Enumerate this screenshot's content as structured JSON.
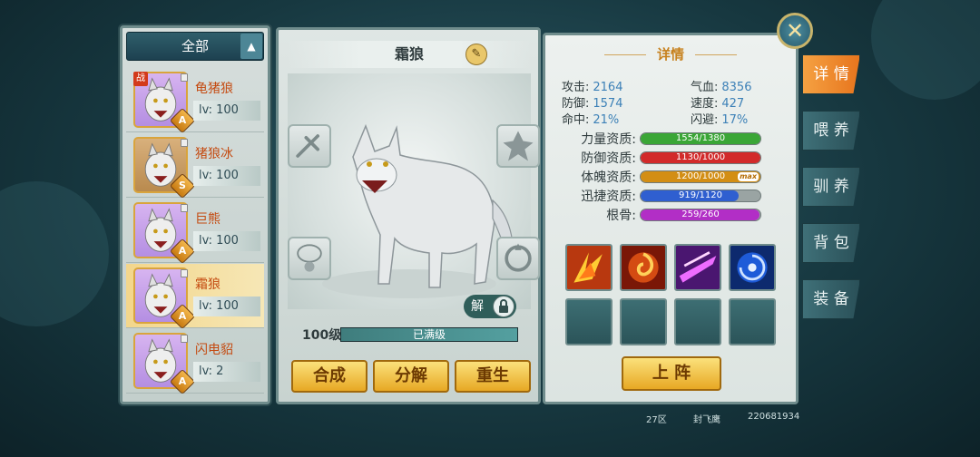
{
  "filter": {
    "label": "全部",
    "toggle_icon": "chevron-up-icon"
  },
  "pets": [
    {
      "name": "龟猪狼",
      "level": "lv: 100",
      "grade": "A",
      "tag": "战",
      "colors": [
        "#d7b4f0",
        "#b48ee2"
      ]
    },
    {
      "name": "猪狼冰",
      "level": "lv: 100",
      "grade": "S",
      "tag": "",
      "colors": [
        "#d8b07c",
        "#b98a4e"
      ]
    },
    {
      "name": "巨熊",
      "level": "lv: 100",
      "grade": "A",
      "tag": "",
      "colors": [
        "#d7b4f0",
        "#b48ee2"
      ]
    },
    {
      "name": "霜狼",
      "level": "lv: 100",
      "grade": "A",
      "tag": "",
      "colors": [
        "#d7b4f0",
        "#b48ee2"
      ]
    },
    {
      "name": "闪电貂",
      "level": "lv: 2",
      "grade": "A",
      "tag": "",
      "colors": [
        "#d7b4f0",
        "#b48ee2"
      ]
    }
  ],
  "selected_index": 3,
  "pet_detail": {
    "name": "霜狼",
    "level_label": "100级",
    "level_status": "已满级",
    "level_progress": 1.0,
    "unlock_label": "解"
  },
  "actions": {
    "compose": "合成",
    "decompose": "分解",
    "rebirth": "重生"
  },
  "detail": {
    "title": "详情",
    "stats": [
      {
        "label": "攻击:",
        "value": "2164"
      },
      {
        "label": "气血:",
        "value": "8356"
      },
      {
        "label": "防御:",
        "value": "1574"
      },
      {
        "label": "速度:",
        "value": "427"
      },
      {
        "label": "命中:",
        "value": "21%"
      },
      {
        "label": "闪避:",
        "value": "17%"
      }
    ],
    "aptitudes": [
      {
        "label": "力量资质:",
        "text": "1554/1380",
        "ratio": 1.0,
        "color": "#3aa636",
        "max": ""
      },
      {
        "label": "防御资质:",
        "text": "1130/1000",
        "ratio": 1.0,
        "color": "#d22a2a",
        "max": ""
      },
      {
        "label": "体魄资质:",
        "text": "1200/1000",
        "ratio": 1.0,
        "color": "#d38e14",
        "max": "max"
      },
      {
        "label": "迅捷资质:",
        "text": "919/1120",
        "ratio": 0.82,
        "color": "#2f5fd0",
        "max": ""
      },
      {
        "label": "根骨:",
        "text": "259/260",
        "ratio": 0.996,
        "color": "#b22ec6",
        "max": ""
      }
    ],
    "skills": [
      "fire-claw-icon",
      "fire-swirl-icon",
      "purple-slash-icon",
      "blue-vortex-icon"
    ],
    "deploy_label": "上 阵"
  },
  "tabs": [
    {
      "label": "详 情",
      "active": true
    },
    {
      "label": "喂 养",
      "active": false
    },
    {
      "label": "驯 养",
      "active": false
    },
    {
      "label": "背 包",
      "active": false
    },
    {
      "label": "装 备",
      "active": false
    }
  ],
  "close_label": "✕",
  "footer": {
    "server": "27区",
    "player": "封飞鹰",
    "id": "220681934"
  }
}
